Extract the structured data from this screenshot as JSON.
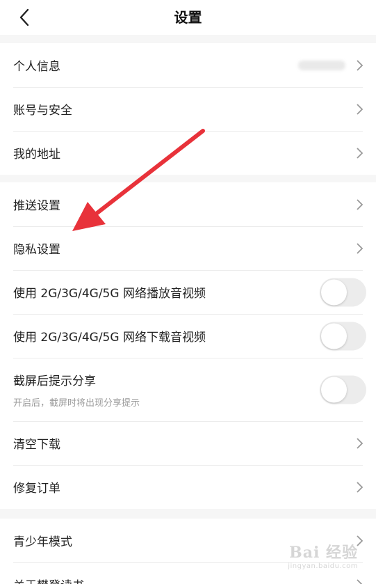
{
  "header": {
    "title": "设置"
  },
  "groups": {
    "account": [
      {
        "label": "个人信息"
      },
      {
        "label": "账号与安全"
      },
      {
        "label": "我的地址"
      }
    ],
    "settings": [
      {
        "label": "推送设置"
      },
      {
        "label": "隐私设置"
      },
      {
        "label": "使用 2G/3G/4G/5G 网络播放音视频",
        "toggle": false
      },
      {
        "label": "使用 2G/3G/4G/5G 网络下载音视频",
        "toggle": false
      },
      {
        "label": "截屏后提示分享",
        "sub": "开启后，截屏时将出现分享提示",
        "toggle": false
      },
      {
        "label": "清空下载"
      },
      {
        "label": "修复订单"
      }
    ],
    "more": [
      {
        "label": "青少年模式"
      },
      {
        "label": "关于樊登读书"
      }
    ]
  },
  "watermark": {
    "main": "Bai 经验",
    "url": "jingyan.baidu.com"
  },
  "colors": {
    "annotation_arrow": "#e8323a",
    "toggle_off": "#ececec"
  }
}
